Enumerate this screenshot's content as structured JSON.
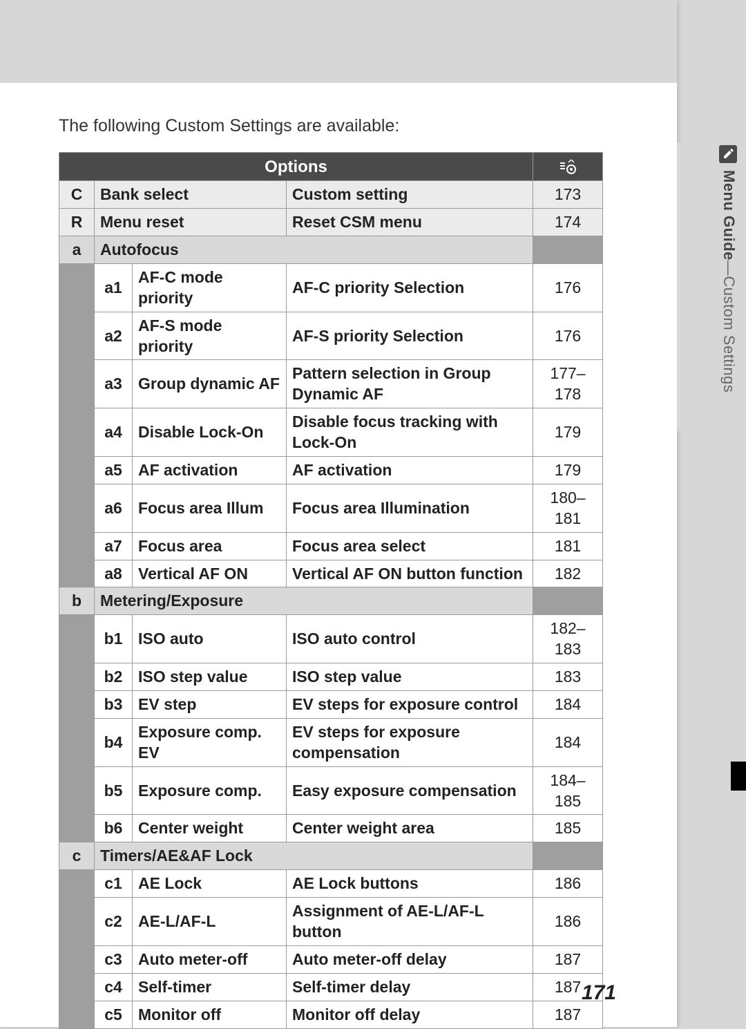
{
  "intro": "The following Custom Settings are available:",
  "header": {
    "options": "Options"
  },
  "top_rows": [
    {
      "code": "C",
      "name": "Bank select",
      "desc": "Custom setting",
      "page": "173"
    },
    {
      "code": "R",
      "name": "Menu reset",
      "desc": "Reset CSM menu",
      "page": "174"
    }
  ],
  "groups": [
    {
      "code": "a",
      "label": "Autofocus",
      "items": [
        {
          "code": "a1",
          "name": "AF-C mode priority",
          "desc": "AF-C priority Selection",
          "page": "176"
        },
        {
          "code": "a2",
          "name": "AF-S mode priority",
          "desc": "AF-S priority Selection",
          "page": "176"
        },
        {
          "code": "a3",
          "name": "Group dynamic AF",
          "desc": "Pattern selection in Group Dynamic AF",
          "page": "177–178"
        },
        {
          "code": "a4",
          "name": "Disable Lock-On",
          "desc": "Disable focus tracking with Lock-On",
          "page": "179"
        },
        {
          "code": "a5",
          "name": "AF activation",
          "desc": "AF activation",
          "page": "179"
        },
        {
          "code": "a6",
          "name": "Focus area Illum",
          "desc": "Focus area Illumination",
          "page": "180–181"
        },
        {
          "code": "a7",
          "name": "Focus area",
          "desc": "Focus area select",
          "page": "181"
        },
        {
          "code": "a8",
          "name": "Vertical AF ON",
          "desc": "Vertical AF ON button function",
          "page": "182"
        }
      ]
    },
    {
      "code": "b",
      "label": "Metering/Exposure",
      "items": [
        {
          "code": "b1",
          "name": "ISO auto",
          "desc": "ISO auto control",
          "page": "182–183"
        },
        {
          "code": "b2",
          "name": "ISO step value",
          "desc": "ISO step value",
          "page": "183"
        },
        {
          "code": "b3",
          "name": "EV step",
          "desc": "EV steps for exposure control",
          "page": "184"
        },
        {
          "code": "b4",
          "name": "Exposure comp. EV",
          "desc": "EV steps for exposure compensation",
          "page": "184"
        },
        {
          "code": "b5",
          "name": "Exposure comp.",
          "desc": "Easy exposure compensation",
          "page": "184–185"
        },
        {
          "code": "b6",
          "name": "Center weight",
          "desc": "Center weight area",
          "page": "185"
        }
      ]
    },
    {
      "code": "c",
      "label": "Timers/AE&AF Lock",
      "items": [
        {
          "code": "c1",
          "name": "AE Lock",
          "desc": "AE Lock buttons",
          "page": "186"
        },
        {
          "code": "c2",
          "name": "AE-L/AF-L",
          "desc": "Assignment of AE-L/AF-L button",
          "page": "186"
        },
        {
          "code": "c3",
          "name": "Auto meter-off",
          "desc": "Auto meter-off delay",
          "page": "187"
        },
        {
          "code": "c4",
          "name": "Self-timer",
          "desc": "Self-timer delay",
          "page": "187"
        },
        {
          "code": "c5",
          "name": "Monitor off",
          "desc": "Monitor off delay",
          "page": "187"
        }
      ]
    }
  ],
  "page_number": "171",
  "side_tab": {
    "section": "Menu Guide",
    "sub": "—Custom Settings"
  }
}
